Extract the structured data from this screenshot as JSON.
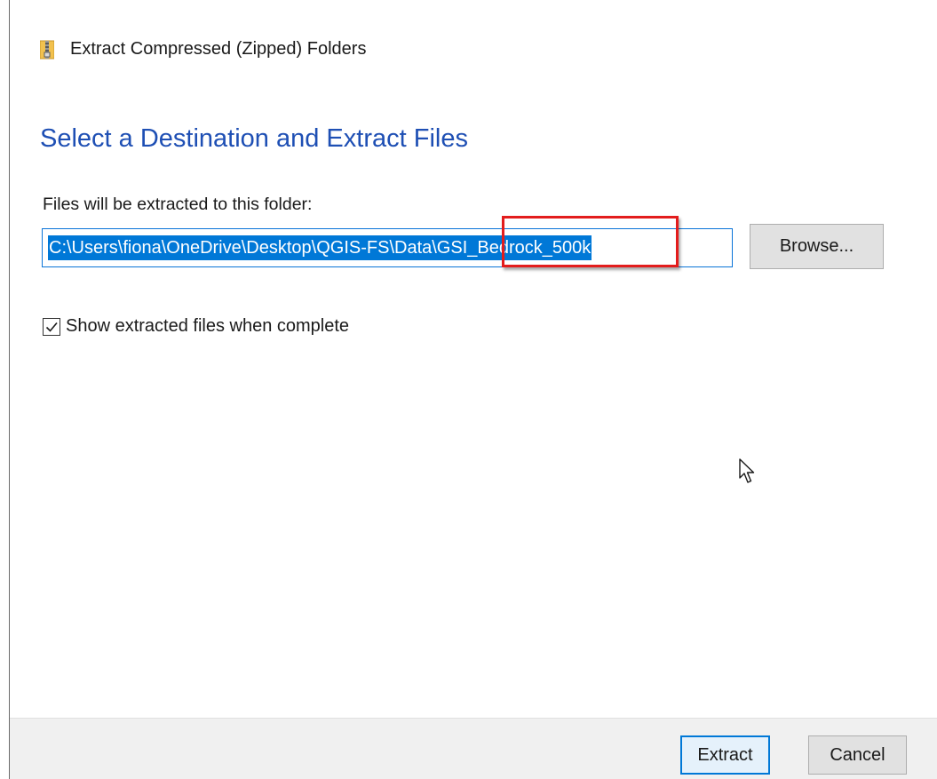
{
  "window": {
    "title": "Extract Compressed (Zipped) Folders",
    "icon": "zip-folder-icon"
  },
  "main": {
    "heading": "Select a Destination and Extract Files",
    "destination_label": "Files will be extracted to this folder:",
    "destination_path": "C:\\Users\\fiona\\OneDrive\\Desktop\\QGIS-FS\\Data\\GSI_Bedrock_500k",
    "browse_label": "Browse...",
    "show_files_label": "Show extracted files when complete",
    "show_files_checked": true
  },
  "footer": {
    "extract_label": "Extract",
    "cancel_label": "Cancel"
  },
  "colors": {
    "heading": "#1e4fb4",
    "selection": "#0078d7",
    "highlight": "#e31d1d"
  }
}
